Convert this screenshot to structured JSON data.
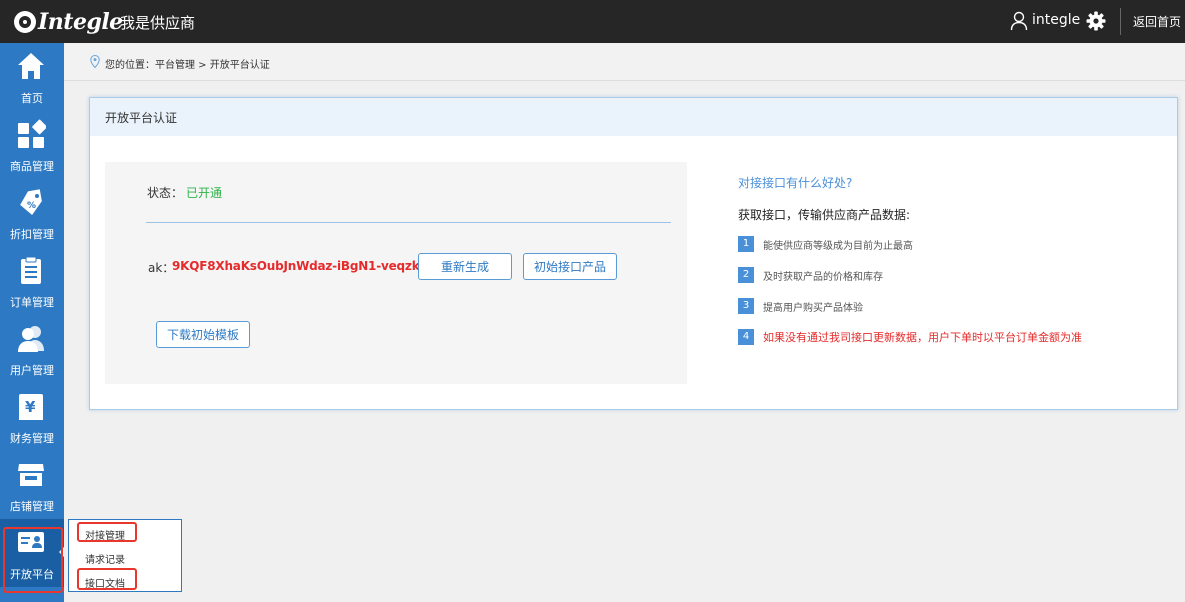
{
  "header": {
    "logo_text": "Integle",
    "app_title": "我是供应商",
    "username": "integle",
    "home_link": "返回首页"
  },
  "sidebar": {
    "items": [
      {
        "label": "首页",
        "icon": "home-icon"
      },
      {
        "label": "商品管理",
        "icon": "products-icon"
      },
      {
        "label": "折扣管理",
        "icon": "discount-icon"
      },
      {
        "label": "订单管理",
        "icon": "orders-icon"
      },
      {
        "label": "用户管理",
        "icon": "users-icon"
      },
      {
        "label": "财务管理",
        "icon": "finance-icon"
      },
      {
        "label": "店铺管理",
        "icon": "store-icon"
      },
      {
        "label": "开放平台",
        "icon": "open-platform-icon",
        "active": true
      }
    ],
    "submenu": [
      "对接管理",
      "请求记录",
      "接口文档"
    ]
  },
  "breadcrumb": {
    "text": "您的位置：平台管理 > 开放平台认证"
  },
  "panel": {
    "title": "开放平台认证",
    "status_label": "状态：",
    "status_value": "已开通",
    "ak_label": "ak：",
    "ak_value": "9KQF8XhaKsOubJnWdaz-iBgN1-veqzki",
    "regenerate_button": "重新生成",
    "init_product_button": "初始接口产品",
    "download_template_button": "下载初始模板"
  },
  "benefits": {
    "title": "对接接口有什么好处?",
    "subtitle": "获取接口，传输供应商产品数据:",
    "items": [
      {
        "num": "1",
        "text": "能使供应商等级成为目前为止最高"
      },
      {
        "num": "2",
        "text": "及时获取产品的价格和库存"
      },
      {
        "num": "3",
        "text": "提高用户购买产品体验"
      },
      {
        "num": "4",
        "text": "如果没有通过我司接口更新数据，用户下单时以平台订单金额为准"
      }
    ]
  },
  "colors": {
    "sidebar": "#2e79c3",
    "topbar": "#262626",
    "status_green": "#2fb44a",
    "ak_red": "#e52b2b",
    "accent_blue": "#4a90d9",
    "highlight_red": "#e8372c"
  }
}
